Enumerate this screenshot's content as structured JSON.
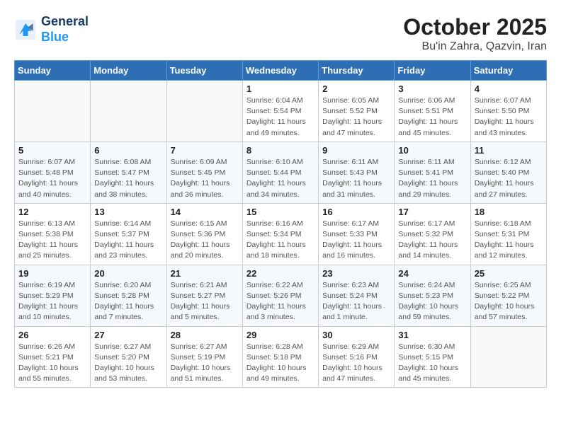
{
  "logo": {
    "line1": "General",
    "line2": "Blue"
  },
  "title": "October 2025",
  "subtitle": "Bu'in Zahra, Qazvin, Iran",
  "headers": [
    "Sunday",
    "Monday",
    "Tuesday",
    "Wednesday",
    "Thursday",
    "Friday",
    "Saturday"
  ],
  "weeks": [
    [
      {
        "day": "",
        "info": ""
      },
      {
        "day": "",
        "info": ""
      },
      {
        "day": "",
        "info": ""
      },
      {
        "day": "1",
        "info": "Sunrise: 6:04 AM\nSunset: 5:54 PM\nDaylight: 11 hours\nand 49 minutes."
      },
      {
        "day": "2",
        "info": "Sunrise: 6:05 AM\nSunset: 5:52 PM\nDaylight: 11 hours\nand 47 minutes."
      },
      {
        "day": "3",
        "info": "Sunrise: 6:06 AM\nSunset: 5:51 PM\nDaylight: 11 hours\nand 45 minutes."
      },
      {
        "day": "4",
        "info": "Sunrise: 6:07 AM\nSunset: 5:50 PM\nDaylight: 11 hours\nand 43 minutes."
      }
    ],
    [
      {
        "day": "5",
        "info": "Sunrise: 6:07 AM\nSunset: 5:48 PM\nDaylight: 11 hours\nand 40 minutes."
      },
      {
        "day": "6",
        "info": "Sunrise: 6:08 AM\nSunset: 5:47 PM\nDaylight: 11 hours\nand 38 minutes."
      },
      {
        "day": "7",
        "info": "Sunrise: 6:09 AM\nSunset: 5:45 PM\nDaylight: 11 hours\nand 36 minutes."
      },
      {
        "day": "8",
        "info": "Sunrise: 6:10 AM\nSunset: 5:44 PM\nDaylight: 11 hours\nand 34 minutes."
      },
      {
        "day": "9",
        "info": "Sunrise: 6:11 AM\nSunset: 5:43 PM\nDaylight: 11 hours\nand 31 minutes."
      },
      {
        "day": "10",
        "info": "Sunrise: 6:11 AM\nSunset: 5:41 PM\nDaylight: 11 hours\nand 29 minutes."
      },
      {
        "day": "11",
        "info": "Sunrise: 6:12 AM\nSunset: 5:40 PM\nDaylight: 11 hours\nand 27 minutes."
      }
    ],
    [
      {
        "day": "12",
        "info": "Sunrise: 6:13 AM\nSunset: 5:38 PM\nDaylight: 11 hours\nand 25 minutes."
      },
      {
        "day": "13",
        "info": "Sunrise: 6:14 AM\nSunset: 5:37 PM\nDaylight: 11 hours\nand 23 minutes."
      },
      {
        "day": "14",
        "info": "Sunrise: 6:15 AM\nSunset: 5:36 PM\nDaylight: 11 hours\nand 20 minutes."
      },
      {
        "day": "15",
        "info": "Sunrise: 6:16 AM\nSunset: 5:34 PM\nDaylight: 11 hours\nand 18 minutes."
      },
      {
        "day": "16",
        "info": "Sunrise: 6:17 AM\nSunset: 5:33 PM\nDaylight: 11 hours\nand 16 minutes."
      },
      {
        "day": "17",
        "info": "Sunrise: 6:17 AM\nSunset: 5:32 PM\nDaylight: 11 hours\nand 14 minutes."
      },
      {
        "day": "18",
        "info": "Sunrise: 6:18 AM\nSunset: 5:31 PM\nDaylight: 11 hours\nand 12 minutes."
      }
    ],
    [
      {
        "day": "19",
        "info": "Sunrise: 6:19 AM\nSunset: 5:29 PM\nDaylight: 11 hours\nand 10 minutes."
      },
      {
        "day": "20",
        "info": "Sunrise: 6:20 AM\nSunset: 5:28 PM\nDaylight: 11 hours\nand 7 minutes."
      },
      {
        "day": "21",
        "info": "Sunrise: 6:21 AM\nSunset: 5:27 PM\nDaylight: 11 hours\nand 5 minutes."
      },
      {
        "day": "22",
        "info": "Sunrise: 6:22 AM\nSunset: 5:26 PM\nDaylight: 11 hours\nand 3 minutes."
      },
      {
        "day": "23",
        "info": "Sunrise: 6:23 AM\nSunset: 5:24 PM\nDaylight: 11 hours\nand 1 minute."
      },
      {
        "day": "24",
        "info": "Sunrise: 6:24 AM\nSunset: 5:23 PM\nDaylight: 10 hours\nand 59 minutes."
      },
      {
        "day": "25",
        "info": "Sunrise: 6:25 AM\nSunset: 5:22 PM\nDaylight: 10 hours\nand 57 minutes."
      }
    ],
    [
      {
        "day": "26",
        "info": "Sunrise: 6:26 AM\nSunset: 5:21 PM\nDaylight: 10 hours\nand 55 minutes."
      },
      {
        "day": "27",
        "info": "Sunrise: 6:27 AM\nSunset: 5:20 PM\nDaylight: 10 hours\nand 53 minutes."
      },
      {
        "day": "28",
        "info": "Sunrise: 6:27 AM\nSunset: 5:19 PM\nDaylight: 10 hours\nand 51 minutes."
      },
      {
        "day": "29",
        "info": "Sunrise: 6:28 AM\nSunset: 5:18 PM\nDaylight: 10 hours\nand 49 minutes."
      },
      {
        "day": "30",
        "info": "Sunrise: 6:29 AM\nSunset: 5:16 PM\nDaylight: 10 hours\nand 47 minutes."
      },
      {
        "day": "31",
        "info": "Sunrise: 6:30 AM\nSunset: 5:15 PM\nDaylight: 10 hours\nand 45 minutes."
      },
      {
        "day": "",
        "info": ""
      }
    ]
  ]
}
